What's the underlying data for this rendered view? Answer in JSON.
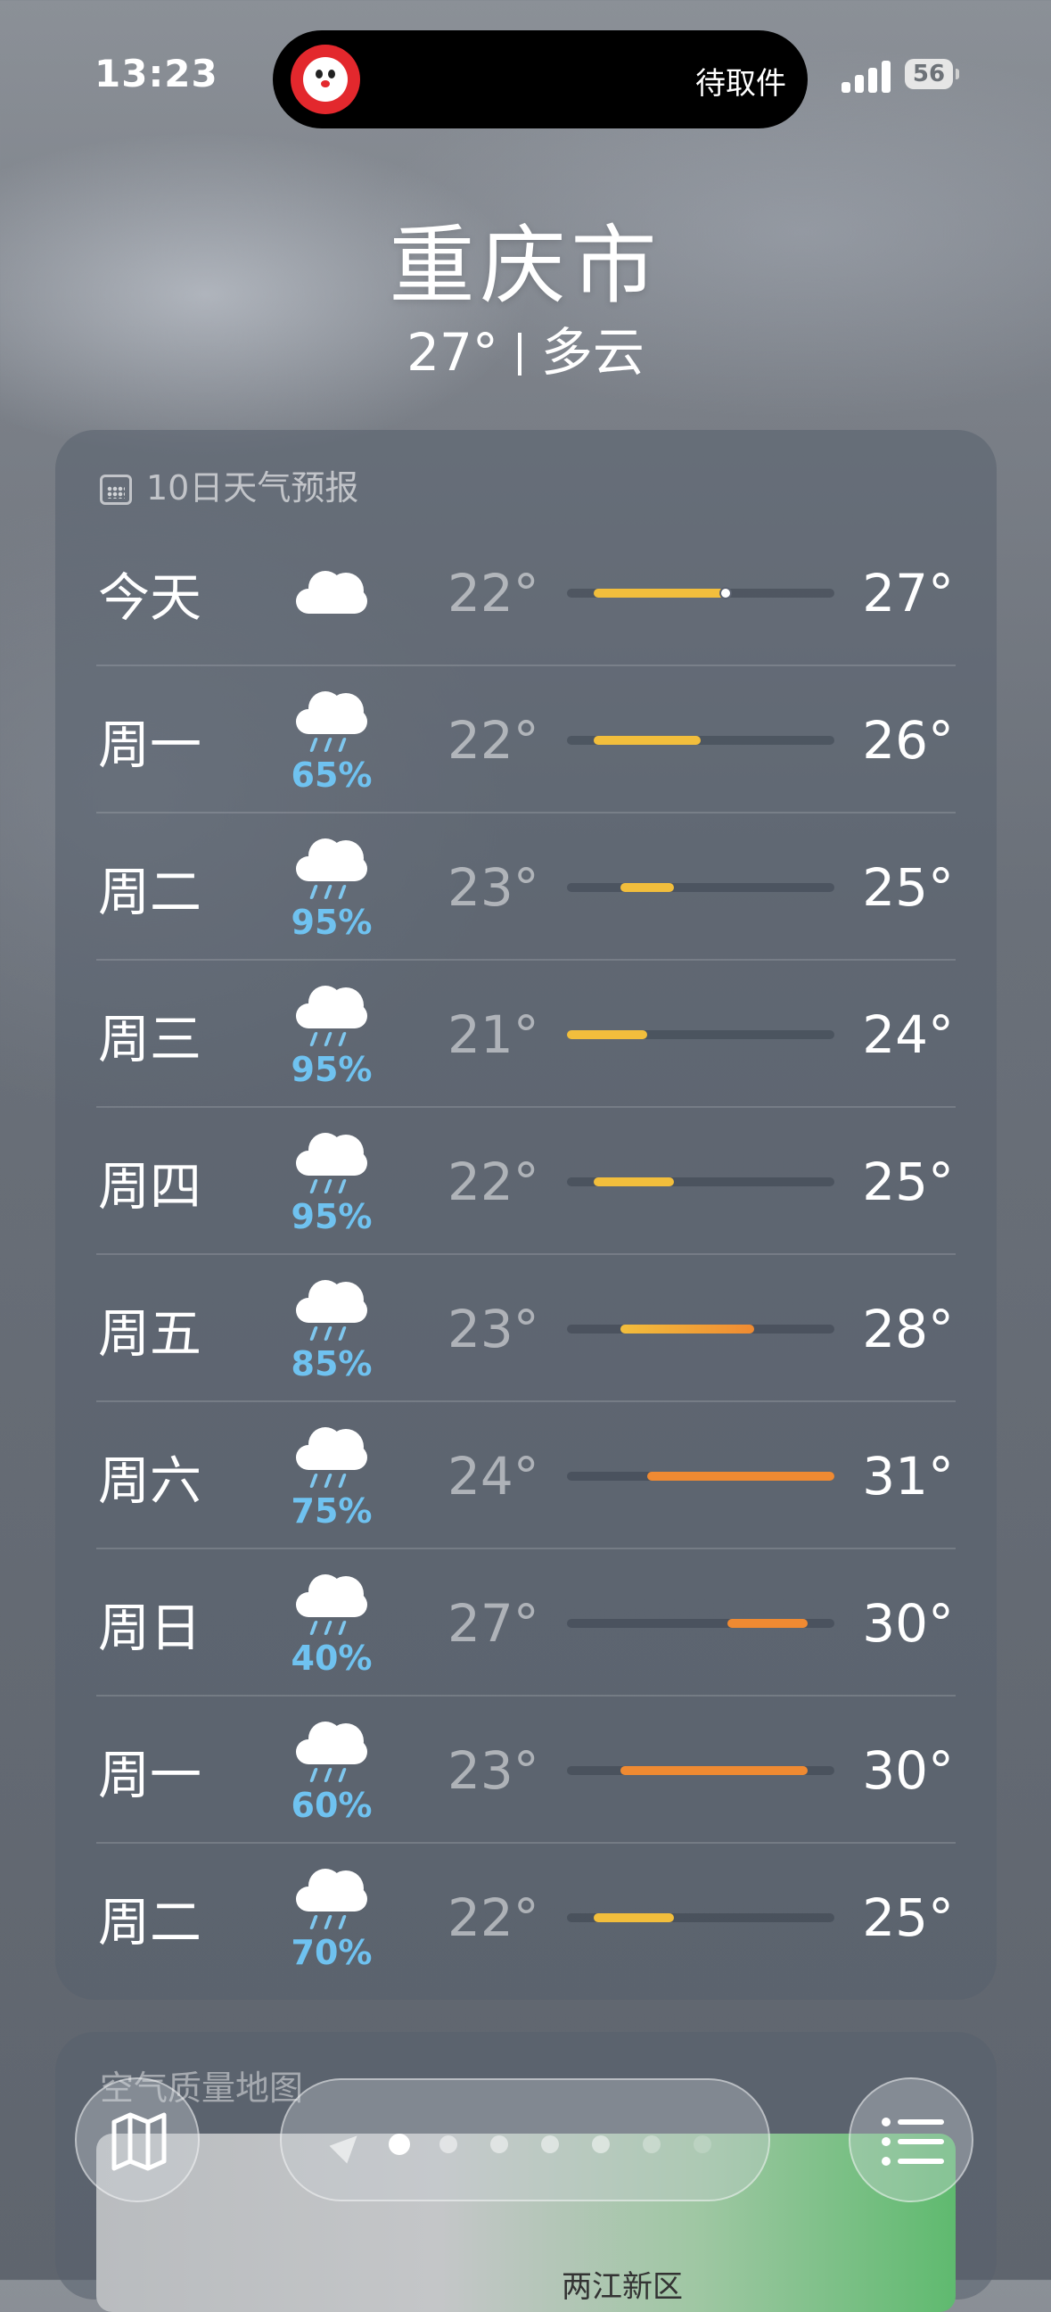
{
  "status_bar": {
    "time": "13:23",
    "island_text": "待取件",
    "battery": "56"
  },
  "header": {
    "city": "重庆市",
    "current_temp": "27°",
    "condition": "多云"
  },
  "forecast": {
    "title": "10日天气预报",
    "icon": "calendar-icon",
    "range_min": 21,
    "range_max": 31,
    "current_temp_value": 27,
    "days": [
      {
        "day": "今天",
        "icon": "cloud-icon",
        "pop": "",
        "lo": "22°",
        "hi": "27°",
        "lo_v": 22,
        "hi_v": 27,
        "current": true
      },
      {
        "day": "周一",
        "icon": "cloud-rain-icon",
        "pop": "65%",
        "lo": "22°",
        "hi": "26°",
        "lo_v": 22,
        "hi_v": 26
      },
      {
        "day": "周二",
        "icon": "cloud-rain-icon",
        "pop": "95%",
        "lo": "23°",
        "hi": "25°",
        "lo_v": 23,
        "hi_v": 25
      },
      {
        "day": "周三",
        "icon": "cloud-rain-icon",
        "pop": "95%",
        "lo": "21°",
        "hi": "24°",
        "lo_v": 21,
        "hi_v": 24
      },
      {
        "day": "周四",
        "icon": "cloud-rain-icon",
        "pop": "95%",
        "lo": "22°",
        "hi": "25°",
        "lo_v": 22,
        "hi_v": 25
      },
      {
        "day": "周五",
        "icon": "cloud-rain-icon",
        "pop": "85%",
        "lo": "23°",
        "hi": "28°",
        "lo_v": 23,
        "hi_v": 28
      },
      {
        "day": "周六",
        "icon": "cloud-rain-icon",
        "pop": "75%",
        "lo": "24°",
        "hi": "31°",
        "lo_v": 24,
        "hi_v": 31
      },
      {
        "day": "周日",
        "icon": "cloud-rain-icon",
        "pop": "40%",
        "lo": "27°",
        "hi": "30°",
        "lo_v": 27,
        "hi_v": 30
      },
      {
        "day": "周一",
        "icon": "cloud-rain-icon",
        "pop": "60%",
        "lo": "23°",
        "hi": "30°",
        "lo_v": 23,
        "hi_v": 30
      },
      {
        "day": "周二",
        "icon": "cloud-rain-icon",
        "pop": "70%",
        "lo": "22°",
        "hi": "25°",
        "lo_v": 22,
        "hi_v": 25
      }
    ]
  },
  "air_quality": {
    "title": "空气质量地图",
    "map_label": "两江新区"
  },
  "bottom_bar": {
    "map_button": "map-icon",
    "list_button": "list-icon",
    "page_count": 7,
    "active_page": 0
  },
  "colors": {
    "bar_warm": "#f2be3c",
    "bar_hot": "#ef8a32",
    "pop": "#6fc2f0"
  }
}
